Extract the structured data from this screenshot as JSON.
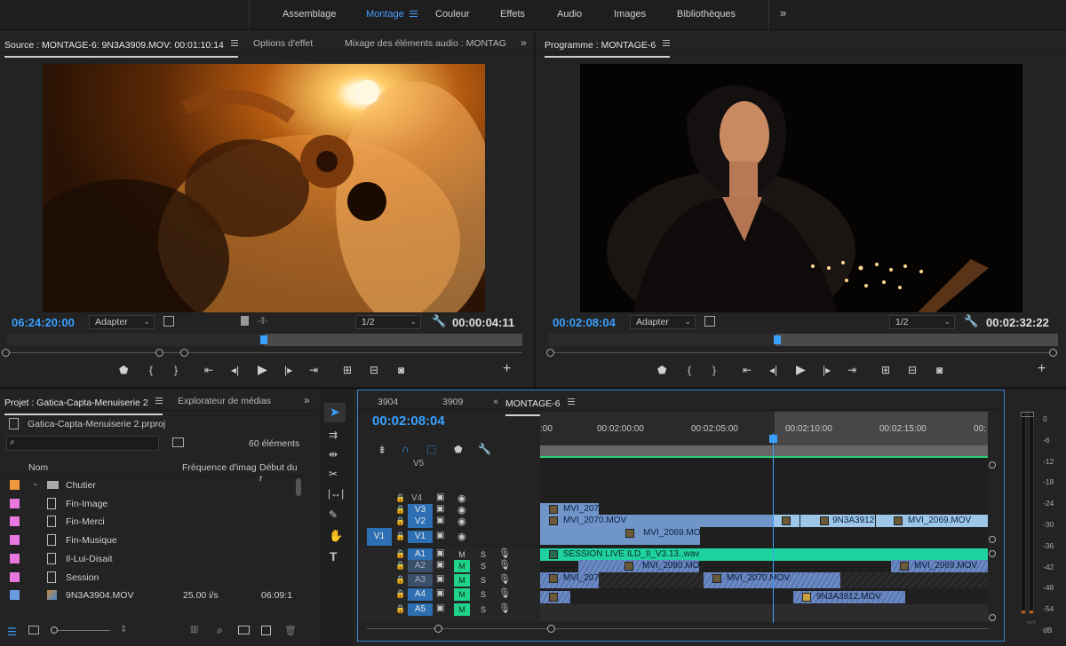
{
  "workspaces": [
    "Assemblage",
    "Montage",
    "Couleur",
    "Effets",
    "Audio",
    "Images",
    "Bibliothèques"
  ],
  "active_workspace": "Montage",
  "overflow": "»",
  "source_panel": {
    "tabs": [
      "Source : MONTAGE-6: 9N3A3909.MOV: 00:01:10:14",
      "Options d'effet",
      "Mixage des éléments audio : MONTAG"
    ],
    "timecode_left": "06:24:20:00",
    "fit": "Adapter",
    "resolution": "1/2",
    "timecode_right": "00:00:04:11"
  },
  "program_panel": {
    "title": "Programme : MONTAGE-6",
    "timecode_left": "00:02:08:04",
    "fit": "Adapter",
    "resolution": "1/2",
    "timecode_right": "00:02:32:22"
  },
  "project_panel": {
    "tabs": [
      "Projet : Gatica-Capta-Menuiserie 2",
      "Explorateur de médias"
    ],
    "project_file": "Gatica-Capta-Menuiserie 2.prproj",
    "count": "60 éléments",
    "columns": [
      "Nom",
      "Fréquence d'imag",
      "Début du r"
    ],
    "items": [
      {
        "name": "Chutier",
        "color": "#f0963c",
        "type": "bin",
        "rate": "",
        "start": ""
      },
      {
        "name": "Fin-Image",
        "color": "#e878e0",
        "type": "seq",
        "rate": "",
        "start": ""
      },
      {
        "name": "Fin-Merci",
        "color": "#e878e0",
        "type": "seq",
        "rate": "",
        "start": ""
      },
      {
        "name": "Fin-Musique",
        "color": "#e878e0",
        "type": "seq",
        "rate": "",
        "start": ""
      },
      {
        "name": "Il-Lui-Disait",
        "color": "#e878e0",
        "type": "seq",
        "rate": "",
        "start": ""
      },
      {
        "name": "Session",
        "color": "#e878e0",
        "type": "seq",
        "rate": "",
        "start": ""
      },
      {
        "name": "9N3A3904.MOV",
        "color": "#6a9be0",
        "type": "clip",
        "rate": "25.00 i/s",
        "start": "06:09:1"
      }
    ]
  },
  "timeline": {
    "tabs": [
      "3904",
      "3909",
      "MONTAGE-6"
    ],
    "close": "×",
    "timecode": "00:02:08:04",
    "ruler": [
      ":00",
      "00:02:00:00",
      "00:02:05:00",
      "00:02:10:00",
      "00:02:15:00",
      "00:"
    ],
    "video_tracks": [
      "V5",
      "V4",
      "V3",
      "V2",
      "V1"
    ],
    "source_patch": "V1",
    "audio_tracks": [
      "A1",
      "A2",
      "A3",
      "A4",
      "A5"
    ],
    "mute": "M",
    "solo": "S",
    "clips": {
      "v3_a": "MVI_207",
      "v2_a": "MVI_2070.MOV",
      "v2_b": "9N3A3912.N",
      "v2_c": "MVI_2069.MOV",
      "v1_a": "MVI_2069.MOV",
      "a1_a": "SESSION LIVE ILD_II_V3.13..wav",
      "a2_a": "MVI_2080.MOV",
      "a2_b": "MVI_2069.MOV",
      "a3_a": "MVI_207",
      "a3_b": "MVI_2070.MOV",
      "a4_a": "9N3A3912.MOV"
    }
  },
  "meter": {
    "scale": [
      "0",
      "-6",
      "-12",
      "-18",
      "-24",
      "-30",
      "-36",
      "-42",
      "-48",
      "-54",
      "dB"
    ]
  },
  "colors": {
    "accent": "#3aa0ff",
    "video_clip": "#6f95c9",
    "video_clip_light": "#9cc7e8",
    "audio_clip": "#1fd3a0"
  }
}
